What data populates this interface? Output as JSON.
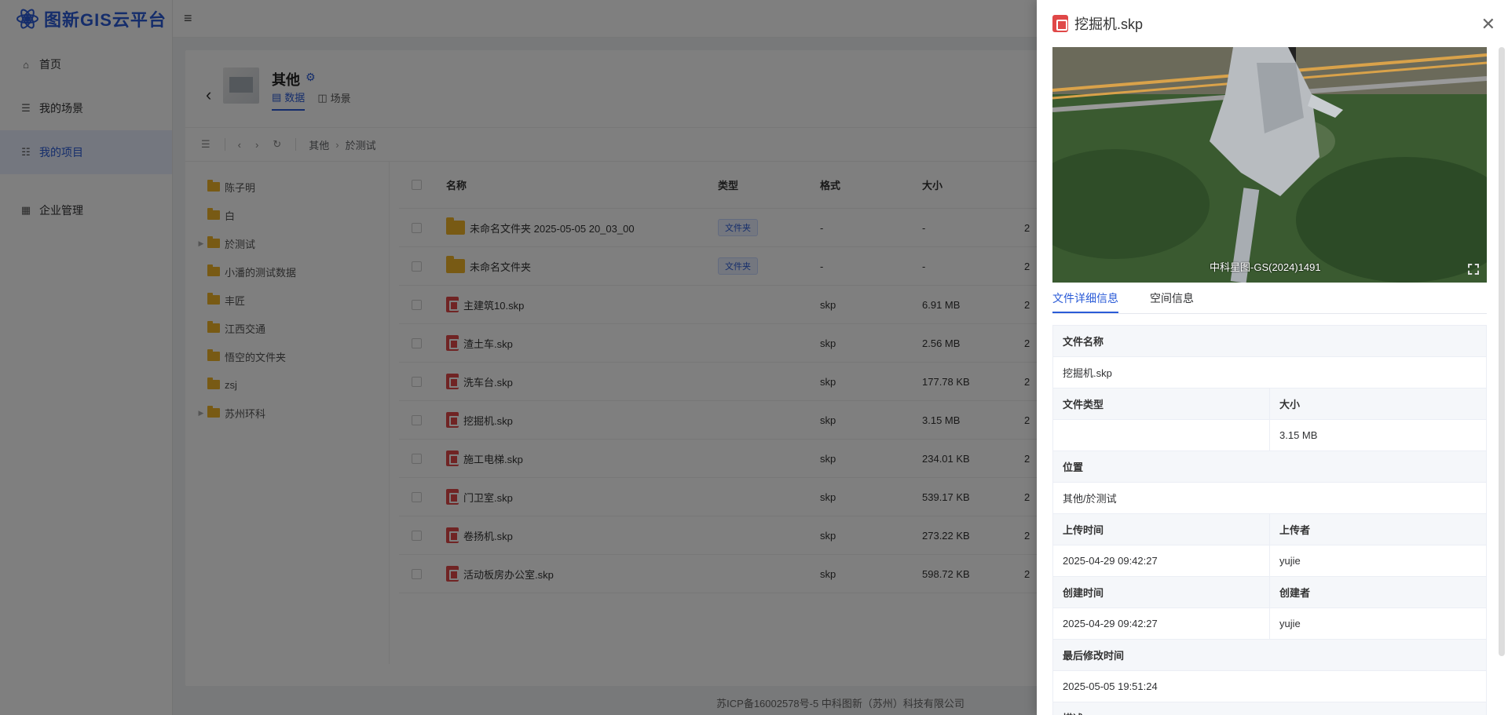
{
  "app": {
    "title": "图新GIS云平台"
  },
  "sidebar": {
    "items": [
      {
        "label": "首页",
        "icon": "home-icon"
      },
      {
        "label": "我的场景",
        "icon": "list-icon"
      },
      {
        "label": "我的项目",
        "icon": "project-icon"
      },
      {
        "label": "企业管理",
        "icon": "building-icon"
      }
    ]
  },
  "project": {
    "title": "其他",
    "tabs": [
      {
        "label": "数据"
      },
      {
        "label": "场景"
      }
    ]
  },
  "breadcrumb": [
    "其他",
    "於测试"
  ],
  "tree": [
    {
      "label": "陈子明",
      "expandable": false
    },
    {
      "label": "白",
      "expandable": false
    },
    {
      "label": "於测试",
      "expandable": true
    },
    {
      "label": "小潘的测试数据",
      "expandable": false
    },
    {
      "label": "丰匠",
      "expandable": false
    },
    {
      "label": "江西交通",
      "expandable": false
    },
    {
      "label": "悟空的文件夹",
      "expandable": false
    },
    {
      "label": "zsj",
      "expandable": false
    },
    {
      "label": "苏州环科",
      "expandable": true
    }
  ],
  "table": {
    "headers": {
      "name": "名称",
      "type": "类型",
      "format": "格式",
      "size": "大小"
    },
    "rows": [
      {
        "name": "未命名文件夹 2025-05-05 20_03_00",
        "type": "文件夹",
        "format": "-",
        "size": "-",
        "kind": "folder",
        "more": "2"
      },
      {
        "name": "未命名文件夹",
        "type": "文件夹",
        "format": "-",
        "size": "-",
        "kind": "folder",
        "more": "2"
      },
      {
        "name": "主建筑10.skp",
        "type": "",
        "format": "skp",
        "size": "6.91 MB",
        "kind": "skp",
        "more": "2"
      },
      {
        "name": "渣土车.skp",
        "type": "",
        "format": "skp",
        "size": "2.56 MB",
        "kind": "skp",
        "more": "2"
      },
      {
        "name": "洗车台.skp",
        "type": "",
        "format": "skp",
        "size": "177.78 KB",
        "kind": "skp",
        "more": "2"
      },
      {
        "name": "挖掘机.skp",
        "type": "",
        "format": "skp",
        "size": "3.15 MB",
        "kind": "skp",
        "more": "2"
      },
      {
        "name": "施工电梯.skp",
        "type": "",
        "format": "skp",
        "size": "234.01 KB",
        "kind": "skp",
        "more": "2"
      },
      {
        "name": "门卫室.skp",
        "type": "",
        "format": "skp",
        "size": "539.17 KB",
        "kind": "skp",
        "more": "2"
      },
      {
        "name": "卷扬机.skp",
        "type": "",
        "format": "skp",
        "size": "273.22 KB",
        "kind": "skp",
        "more": "2"
      },
      {
        "name": "活动板房办公室.skp",
        "type": "",
        "format": "skp",
        "size": "598.72 KB",
        "kind": "skp",
        "more": "2"
      }
    ]
  },
  "footer": "苏ICP备16002578号-5 中科图新（苏州）科技有限公司",
  "drawer": {
    "title": "挖掘机.skp",
    "watermark": "中科星图-GS(2024)1491",
    "tabs": [
      {
        "label": "文件详细信息"
      },
      {
        "label": "空间信息"
      }
    ],
    "info": {
      "file_name_label": "文件名称",
      "file_name": "挖掘机.skp",
      "file_type_label": "文件类型",
      "file_type": "",
      "size_label": "大小",
      "size": "3.15 MB",
      "location_label": "位置",
      "location": "其他/於测试",
      "upload_time_label": "上传时间",
      "upload_time": "2025-04-29 09:42:27",
      "uploader_label": "上传者",
      "uploader": "yujie",
      "create_time_label": "创建时间",
      "create_time": "2025-04-29 09:42:27",
      "creator_label": "创建者",
      "creator": "yujie",
      "modified_label": "最后修改时间",
      "modified": "2025-05-05 19:51:24",
      "desc_label": "描述"
    }
  },
  "colors": {
    "accent": "#2a5bd7",
    "folder": "#f0b429",
    "skp": "#e04848"
  }
}
